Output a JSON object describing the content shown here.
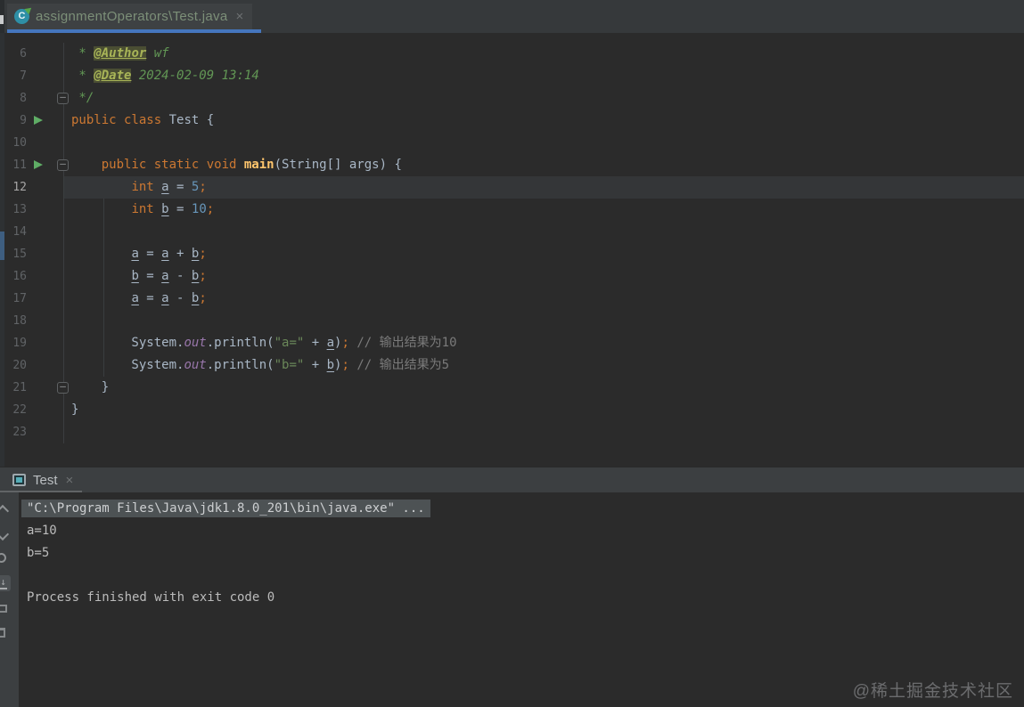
{
  "colors": {
    "editor_background": "#2B2B2B",
    "panel_background": "#3C3F41",
    "active_tab_underline": "#4576BE",
    "keyword_orange": "#CC7832",
    "number_blue": "#6897BB",
    "string_green": "#6A8759",
    "comment_gray": "#7A7A7A",
    "doc_comment_green": "#629755",
    "doc_tag_olive": "#A8B457",
    "field_purple": "#9876AA",
    "method_yellow": "#FFC66D",
    "run_green": "#5FAD65"
  },
  "icons": {
    "editor_tab_icon": "java-runnable-class-icon",
    "run_tab_icon": "run-console-icon",
    "gutter_icons": [
      "run-line-icon",
      "fold-up-icon",
      "fold-down-icon"
    ],
    "console_toolbar_icons": [
      "up-stack-trace-icon",
      "down-stack-trace-icon",
      "rerun-icon",
      "scroll-to-end-icon",
      "print-icon",
      "clear-all-icon"
    ]
  },
  "editor_tab": {
    "label": "assignmentOperators\\Test.java",
    "close": "×"
  },
  "editor": {
    "lines": [
      {
        "n": 6,
        "seg": [
          [
            "doc",
            " * "
          ],
          [
            "tag",
            "@Author"
          ],
          [
            "doc",
            " wf"
          ]
        ]
      },
      {
        "n": 7,
        "seg": [
          [
            "doc",
            " * "
          ],
          [
            "tag",
            "@Date"
          ],
          [
            "doc",
            " 2024-02-09 13:14"
          ]
        ]
      },
      {
        "n": 8,
        "fold": "up",
        "seg": [
          [
            "doc",
            " */"
          ]
        ]
      },
      {
        "n": 9,
        "run": true,
        "seg": [
          [
            "kw",
            "public class"
          ],
          [
            "pln",
            " Test {"
          ]
        ]
      },
      {
        "n": 10,
        "seg": []
      },
      {
        "n": 11,
        "run": true,
        "fold": "down",
        "seg": [
          [
            "pln",
            "    "
          ],
          [
            "kw",
            "public static void"
          ],
          [
            "pln",
            " "
          ],
          [
            "mth",
            "main"
          ],
          [
            "pln",
            "(String[] args) {"
          ]
        ]
      },
      {
        "n": 12,
        "cur": true,
        "seg": [
          [
            "pln",
            "        "
          ],
          [
            "kw",
            "int"
          ],
          [
            "pln",
            " "
          ],
          [
            "var",
            "a"
          ],
          [
            "pln",
            " = "
          ],
          [
            "num",
            "5"
          ],
          [
            "semi",
            ";"
          ]
        ]
      },
      {
        "n": 13,
        "seg": [
          [
            "pln",
            "        "
          ],
          [
            "kw",
            "int"
          ],
          [
            "pln",
            " "
          ],
          [
            "var",
            "b"
          ],
          [
            "pln",
            " = "
          ],
          [
            "num",
            "10"
          ],
          [
            "semi",
            ";"
          ]
        ]
      },
      {
        "n": 14,
        "seg": []
      },
      {
        "n": 15,
        "seg": [
          [
            "pln",
            "        "
          ],
          [
            "var",
            "a"
          ],
          [
            "pln",
            " = "
          ],
          [
            "var",
            "a"
          ],
          [
            "pln",
            " + "
          ],
          [
            "var",
            "b"
          ],
          [
            "semi",
            ";"
          ]
        ]
      },
      {
        "n": 16,
        "seg": [
          [
            "pln",
            "        "
          ],
          [
            "var",
            "b"
          ],
          [
            "pln",
            " = "
          ],
          [
            "var",
            "a"
          ],
          [
            "pln",
            " - "
          ],
          [
            "var",
            "b"
          ],
          [
            "semi",
            ";"
          ]
        ]
      },
      {
        "n": 17,
        "seg": [
          [
            "pln",
            "        "
          ],
          [
            "var",
            "a"
          ],
          [
            "pln",
            " = "
          ],
          [
            "var",
            "a"
          ],
          [
            "pln",
            " - "
          ],
          [
            "var",
            "b"
          ],
          [
            "semi",
            ";"
          ]
        ]
      },
      {
        "n": 18,
        "seg": []
      },
      {
        "n": 19,
        "seg": [
          [
            "pln",
            "        System."
          ],
          [
            "fld",
            "out"
          ],
          [
            "pln",
            ".println("
          ],
          [
            "str",
            "\"a=\""
          ],
          [
            "pln",
            " + "
          ],
          [
            "var",
            "a"
          ],
          [
            "pln",
            ")"
          ],
          [
            "semi",
            ";"
          ],
          [
            "cmt",
            " // 输出结果为10"
          ]
        ]
      },
      {
        "n": 20,
        "seg": [
          [
            "pln",
            "        System."
          ],
          [
            "fld",
            "out"
          ],
          [
            "pln",
            ".println("
          ],
          [
            "str",
            "\"b=\""
          ],
          [
            "pln",
            " + "
          ],
          [
            "var",
            "b"
          ],
          [
            "pln",
            ")"
          ],
          [
            "semi",
            ";"
          ],
          [
            "cmt",
            " // 输出结果为5"
          ]
        ]
      },
      {
        "n": 21,
        "fold": "up",
        "seg": [
          [
            "pln",
            "    }"
          ]
        ]
      },
      {
        "n": 22,
        "seg": [
          [
            "pln",
            "}"
          ]
        ]
      },
      {
        "n": 23,
        "seg": []
      }
    ]
  },
  "run_panel": {
    "tab": {
      "label": "Test",
      "close": "×"
    },
    "console": {
      "command": "\"C:\\Program Files\\Java\\jdk1.8.0_201\\bin\\java.exe\" ...",
      "output": [
        "a=10",
        "b=5",
        "",
        "Process finished with exit code 0"
      ]
    }
  },
  "watermark": "@稀土掘金技术社区"
}
